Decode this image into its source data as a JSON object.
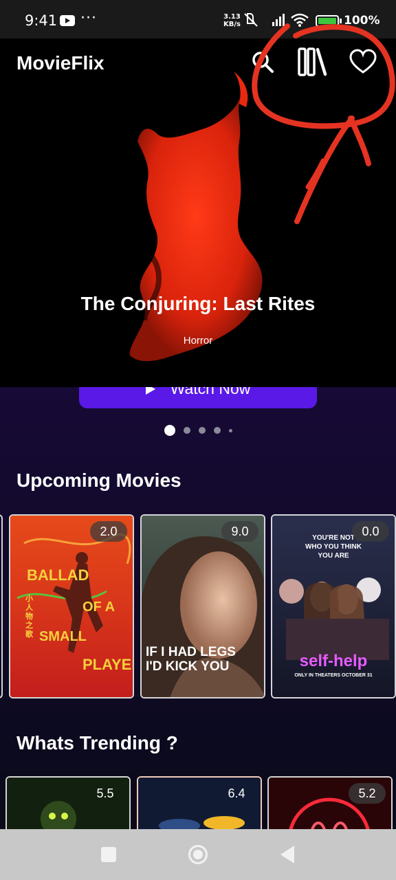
{
  "status_bar": {
    "time": "9:41",
    "net_speed_value": "3.13",
    "net_speed_unit": "KB/s",
    "battery": "100%",
    "icons": [
      "youtube-icon",
      "more-icon",
      "mute-icon",
      "signal-icon",
      "wifi-icon",
      "battery-icon"
    ]
  },
  "app": {
    "title": "MovieFlix"
  },
  "header": {
    "icons": [
      "search-icon",
      "library-icon",
      "heart-icon"
    ]
  },
  "hero": {
    "title": "The Conjuring: Last Rites",
    "genre": "Horror",
    "watch_label": "Watch Now",
    "carousel": {
      "count": 5,
      "active_index": 0
    }
  },
  "upcoming": {
    "title": "Upcoming Movies",
    "items": [
      {
        "rating": "2.0",
        "poster_lines": [
          "BALLAD",
          "OF A",
          "SMALL",
          "PLAYER"
        ],
        "poster_sub": "小人物之歌"
      },
      {
        "rating": "9.0",
        "poster_lines": [
          "IF I HAD LEGS",
          "I'D KICK YOU"
        ]
      },
      {
        "rating": "0.0",
        "poster_lines": [
          "YOU'RE NOT",
          "WHO YOU THINK",
          "YOU ARE"
        ],
        "poster_title": "self-help",
        "poster_sub": "ONLY IN THEATERS OCTOBER 31"
      }
    ]
  },
  "trending": {
    "title": "Whats Trending ?",
    "items": [
      {
        "rating": "5.5"
      },
      {
        "rating": "6.4"
      },
      {
        "rating": "5.2"
      }
    ]
  },
  "colors": {
    "accent": "#5a19e6",
    "background": "#0e0a24",
    "hero_figure": "#e8290f",
    "annotation": "#e53322"
  }
}
